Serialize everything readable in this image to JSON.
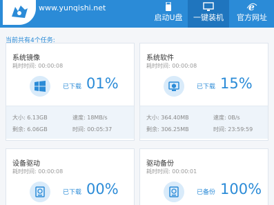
{
  "header": {
    "site_url": "www.yunqishi.net",
    "nav": [
      {
        "label": "启动U盘",
        "icon": "usb-icon"
      },
      {
        "label": "一键装机",
        "icon": "monitor-icon",
        "active": true
      },
      {
        "label": "官方网址",
        "icon": "ie-icon"
      }
    ]
  },
  "summary": "当前共有4个任务:",
  "tasks": [
    {
      "title": "系统镜像",
      "elapsed": "耗时时间:  00:00:08",
      "state": "已下载",
      "percent": "01%",
      "icon": "windows-icon",
      "size": "大小:  6.13GB",
      "remain": "剩余:  6.06GB",
      "speed": "速度:  18MB/s",
      "time": "时间:  00:05:37"
    },
    {
      "title": "系统软件",
      "elapsed": "耗时时间:  00:00:08",
      "state": "已下载",
      "percent": "15%",
      "icon": "software-box-icon",
      "size": "大小:  364.40MB",
      "remain": "剩余:  306.25MB",
      "speed": "速度:  0B/s",
      "time": "时间:  23:59:59"
    },
    {
      "title": "设备驱动",
      "elapsed": "耗时时间:  00:00:08",
      "state": "已下载",
      "percent": "00%",
      "icon": "driver-disk-icon"
    },
    {
      "title": "驱动备份",
      "elapsed": "耗时时间:  00:00:01",
      "state": "已备份",
      "percent": "100%",
      "icon": "backup-disk-icon"
    }
  ],
  "colors": {
    "accent": "#2b8bd7",
    "topbar": "#2b8bd7",
    "active_tab": "#1f75be"
  }
}
